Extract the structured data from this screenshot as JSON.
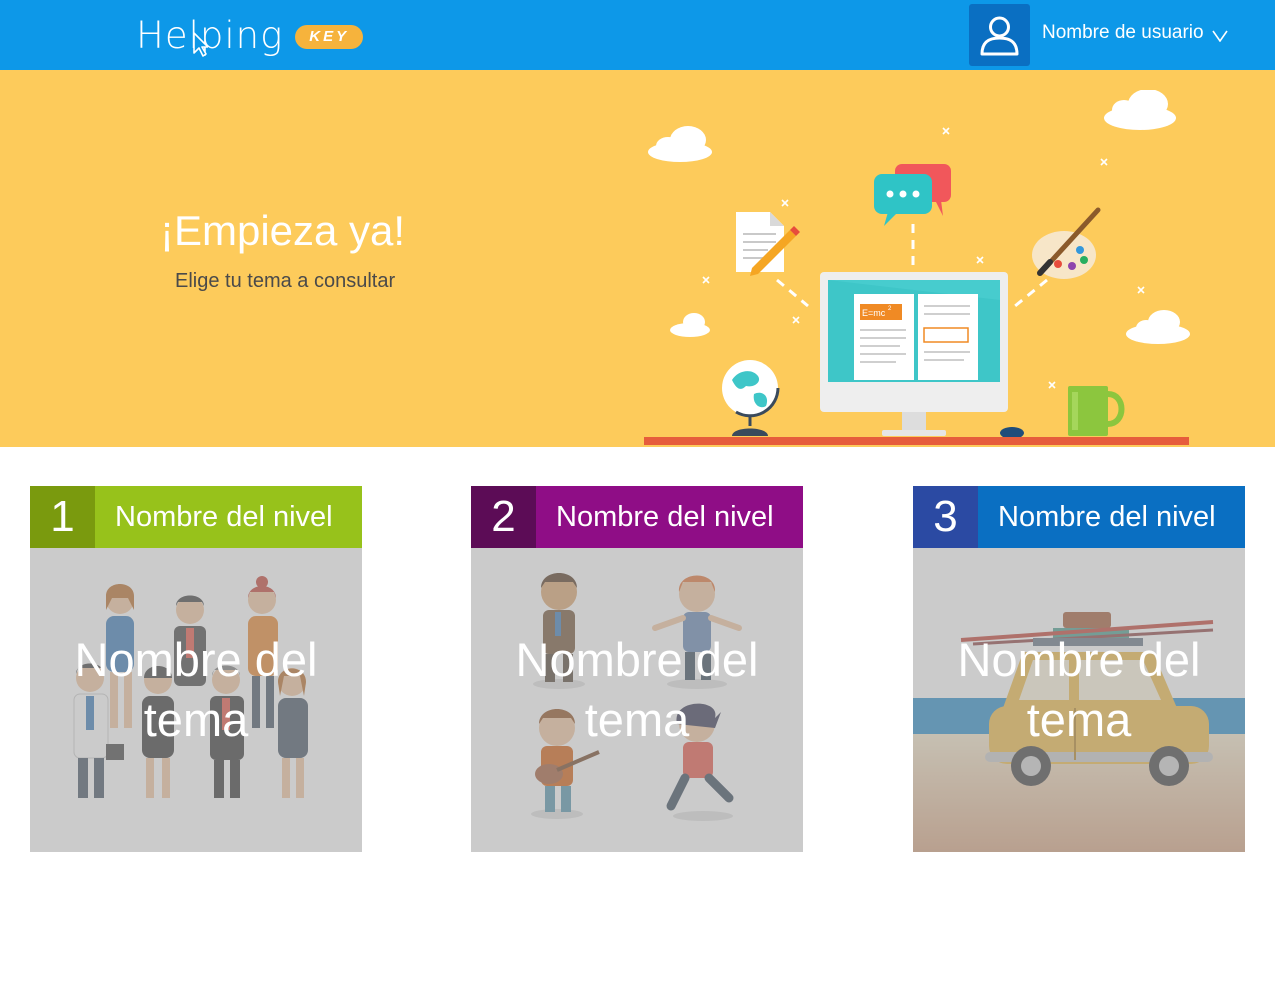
{
  "header": {
    "logo_text": "Helping",
    "logo_badge": "KEY",
    "user_icon": "user-icon",
    "username": "Nombre de usuario",
    "menu_icon": "chevron-down-icon",
    "brand_color": "#0d98e8"
  },
  "hero": {
    "title": "¡Empieza ya!",
    "subtitle": "Elige tu tema a consultar",
    "formula": "E=mc",
    "formula_exp": "2",
    "background": "#fdcb5b"
  },
  "cards": [
    {
      "number": "1",
      "level": "Nombre del nivel",
      "topic_line1": "Nombre del",
      "topic_line2": "tema",
      "num_color": "#7a9a0e",
      "level_color": "#97c21b",
      "illustration": "business-people-icon"
    },
    {
      "number": "2",
      "level": "Nombre del nivel",
      "topic_line1": "Nombre del",
      "topic_line2": "tema",
      "num_color": "#5c0c56",
      "level_color": "#8f0d86",
      "illustration": "kids-playing-icon"
    },
    {
      "number": "3",
      "level": "Nombre del nivel",
      "topic_line1": "Nombre del",
      "topic_line2": "tema",
      "num_color": "#2b4aa3",
      "level_color": "#0a6fc2",
      "illustration": "car-trip-icon"
    }
  ]
}
